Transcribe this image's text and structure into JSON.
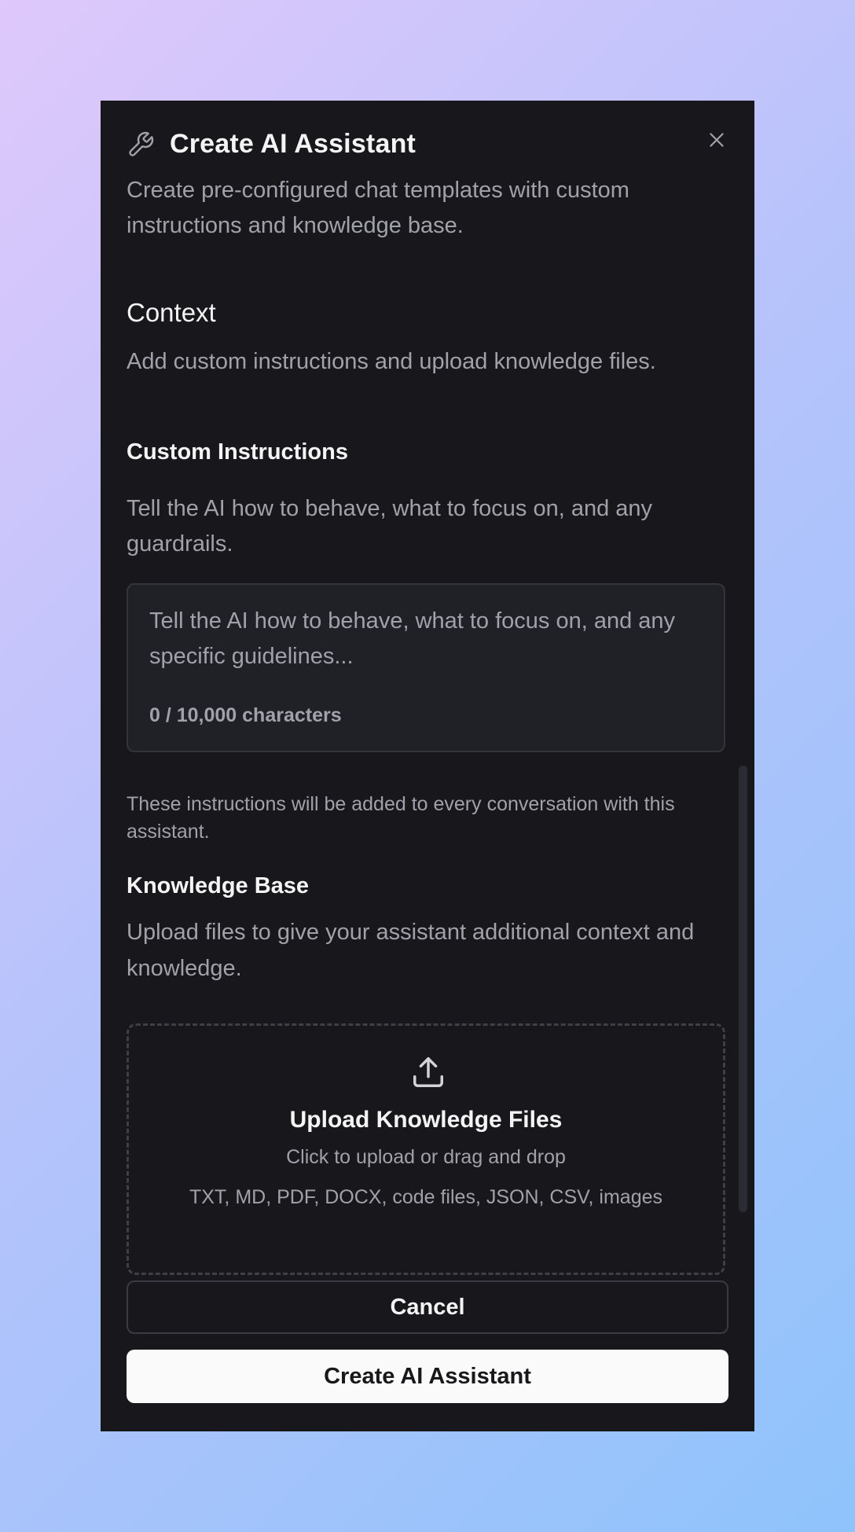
{
  "dialog": {
    "title": "Create AI Assistant",
    "subtitle": "Create pre-configured chat templates with custom instructions and knowledge base.",
    "header_icon": "wrench-icon",
    "close_icon": "close-icon"
  },
  "context": {
    "title": "Context",
    "description": "Add custom instructions and upload knowledge files."
  },
  "custom_instructions": {
    "label": "Custom Instructions",
    "description": "Tell the AI how to behave, what to focus on, and any guardrails.",
    "placeholder": "Tell the AI how to behave, what to focus on, and any specific guidelines...",
    "value": "",
    "counter": "0 / 10,000 characters",
    "hint": "These instructions will be added to every conversation with this assistant."
  },
  "knowledge_base": {
    "label": "Knowledge Base",
    "description": "Upload files to give your assistant additional context and knowledge.",
    "upload_icon": "upload-icon",
    "upload_title": "Upload Knowledge Files",
    "upload_subtitle": "Click to upload or drag and drop",
    "file_types": "TXT, MD, PDF, DOCX, code files, JSON, CSV, images"
  },
  "footer": {
    "cancel_label": "Cancel",
    "create_label": "Create AI Assistant"
  },
  "colors": {
    "dialog_bg": "#18181c",
    "text_primary": "#f4f4f5",
    "text_muted": "#a1a1aa",
    "primary_button_bg": "#fafafa"
  }
}
